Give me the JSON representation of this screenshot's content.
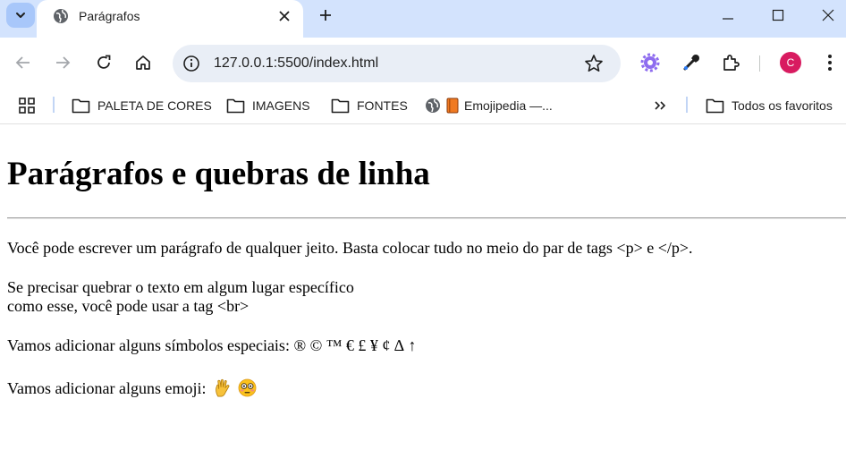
{
  "browser": {
    "tab": {
      "title": "Parágrafos"
    },
    "omnibox": {
      "url": "127.0.0.1:5500/index.html"
    },
    "profile_initial": "C",
    "colors": {
      "tabstrip": "#d3e3fd",
      "omnibox": "#e9eef6",
      "avatar": "#d81b60"
    }
  },
  "bookmarks": {
    "items": [
      {
        "label": "PALETA DE CORES",
        "icon": "folder-icon"
      },
      {
        "label": "IMAGENS",
        "icon": "folder-icon"
      },
      {
        "label": "FONTES",
        "icon": "folder-icon"
      },
      {
        "label": "Emojipedia —...",
        "icon": "globe-icon"
      }
    ],
    "all_bookmarks": "Todos os favoritos"
  },
  "page": {
    "heading": "Parágrafos e quebras de linha",
    "paragraph1": "Você pode escrever um parágrafo de qualquer jeito. Basta colocar tudo no meio do par de tags <p> e </p>.",
    "paragraph2_line1": "Se precisar quebrar o texto em algum lugar específico",
    "paragraph2_line2": "como esse, você pode usar a tag <br>",
    "paragraph3": "Vamos adicionar alguns símbolos especiais: ® © ™ € £ ¥ ¢ ∆ ↑",
    "paragraph4": "Vamos adicionar alguns emoji:",
    "emojis": [
      "vulcan-salute-emoji",
      "flushed-face-emoji"
    ]
  }
}
